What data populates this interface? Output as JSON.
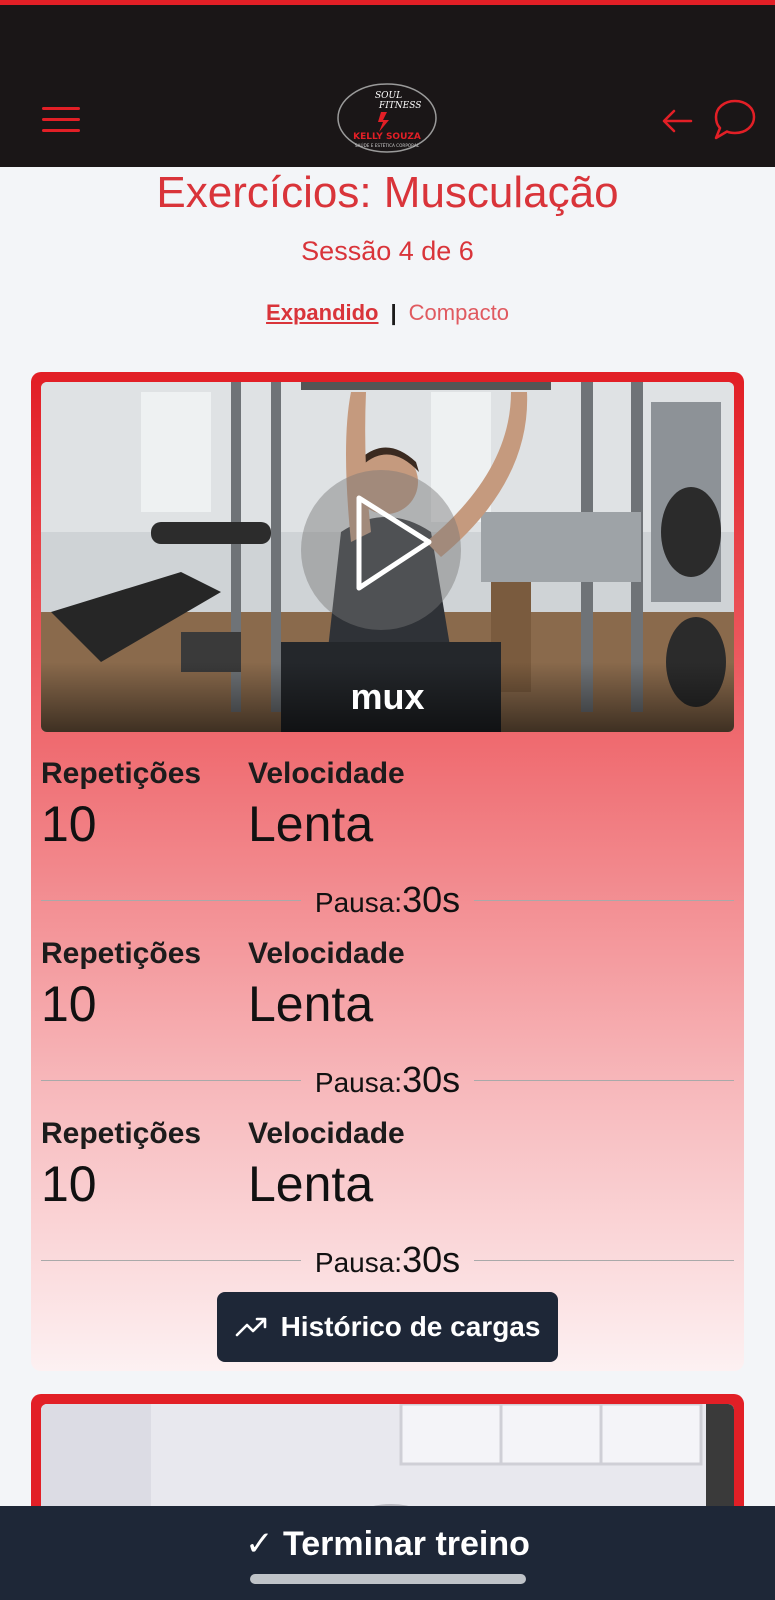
{
  "header": {
    "logo": {
      "line1": "SOUL",
      "line2": "FITNESS",
      "line3": "KELLY SOUZA",
      "line4": "SAÚDE E ESTÉTICA CORPORAL"
    }
  },
  "page": {
    "title": "Exercícios: Musculação",
    "session": "Sessão 4 de 6",
    "view_toggle": {
      "expanded": "Expandido",
      "separator": "|",
      "compact": "Compacto"
    }
  },
  "exercise": {
    "video_caption": "mux",
    "sets": [
      {
        "reps_label": "Repetições",
        "reps": "10",
        "speed_label": "Velocidade",
        "speed": "Lenta",
        "pause_label": "Pausa:",
        "pause": "30s"
      },
      {
        "reps_label": "Repetições",
        "reps": "10",
        "speed_label": "Velocidade",
        "speed": "Lenta",
        "pause_label": "Pausa:",
        "pause": "30s"
      },
      {
        "reps_label": "Repetições",
        "reps": "10",
        "speed_label": "Velocidade",
        "speed": "Lenta",
        "pause_label": "Pausa:",
        "pause": "30s"
      }
    ],
    "history_button": "Histórico de cargas"
  },
  "footer": {
    "finish_label": "✓ Terminar treino"
  },
  "colors": {
    "accent": "#e21f26",
    "header_bg": "#1a1617",
    "dark_button": "#1e2737"
  }
}
